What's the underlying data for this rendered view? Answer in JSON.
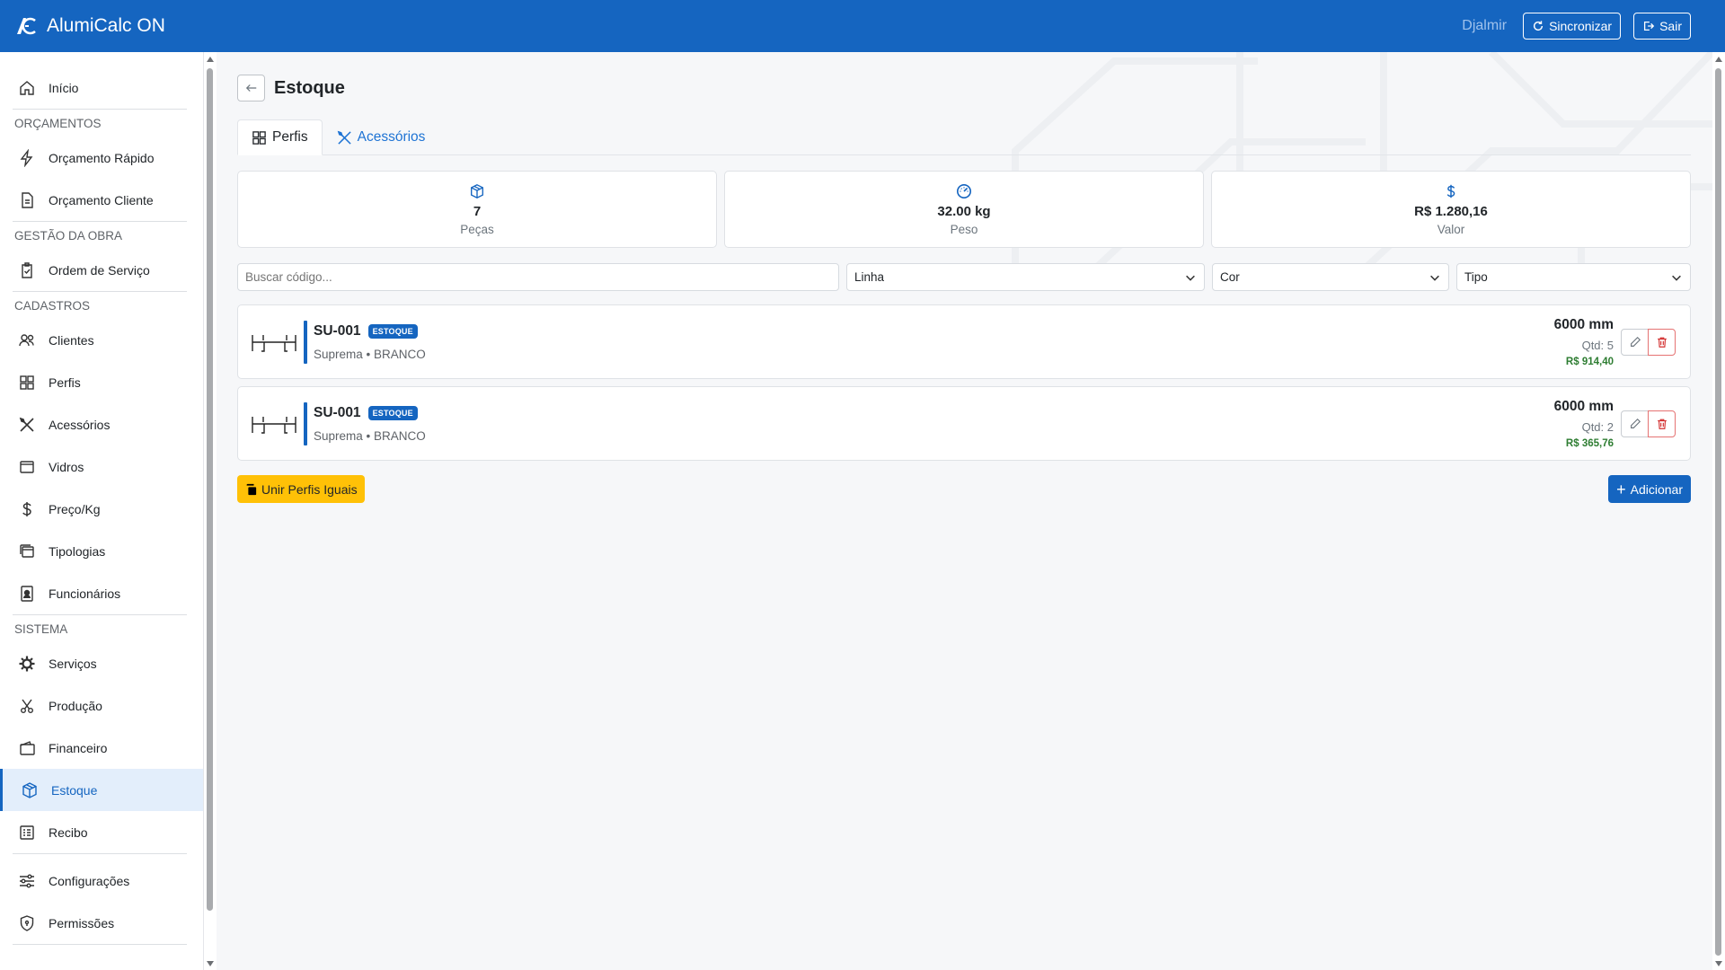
{
  "app": {
    "title": "AlumiCalc ON"
  },
  "header": {
    "user": "Djalmir",
    "sync_label": "Sincronizar",
    "exit_label": "Sair"
  },
  "sidebar": {
    "home": "Início",
    "sections": {
      "orcamentos": "ORÇAMENTOS",
      "gestao": "GESTÃO DA OBRA",
      "cadastros": "CADASTROS",
      "sistema": "SISTEMA"
    },
    "items": {
      "orcamento_rapido": "Orçamento Rápido",
      "orcamento_cliente": "Orçamento Cliente",
      "ordem_servico": "Ordem de Serviço",
      "clientes": "Clientes",
      "perfis": "Perfis",
      "acessorios": "Acessórios",
      "vidros": "Vidros",
      "preco_kg": "Preço/Kg",
      "tipologias": "Tipologias",
      "funcionarios": "Funcionários",
      "servicos": "Serviços",
      "producao": "Produção",
      "financeiro": "Financeiro",
      "estoque": "Estoque",
      "recibo": "Recibo",
      "configuracoes": "Configurações",
      "permissoes": "Permissões"
    },
    "active": "estoque"
  },
  "page": {
    "title": "Estoque",
    "tabs": [
      {
        "label": "Perfis",
        "active": true
      },
      {
        "label": "Acessórios",
        "active": false
      }
    ]
  },
  "stats": [
    {
      "icon": "box-icon",
      "value": "7",
      "label": "Peças"
    },
    {
      "icon": "gauge-icon",
      "value": "32.00 kg",
      "label": "Peso"
    },
    {
      "icon": "dollar-icon",
      "value": "R$ 1.280,16",
      "label": "Valor"
    }
  ],
  "filters": {
    "search_placeholder": "Buscar código...",
    "linha": "Linha",
    "cor": "Cor",
    "tipo": "Tipo"
  },
  "items": [
    {
      "code": "SU-001",
      "badge": "ESTOQUE",
      "line": "Suprema • BRANCO",
      "length": "6000 mm",
      "qty": "Qtd: 5",
      "price": "R$ 914,40"
    },
    {
      "code": "SU-001",
      "badge": "ESTOQUE",
      "line": "Suprema • BRANCO",
      "length": "6000 mm",
      "qty": "Qtd: 2",
      "price": "R$ 365,76"
    }
  ],
  "actions": {
    "merge_label": "Unir Perfis Iguais",
    "add_label": "Adicionar"
  },
  "colors": {
    "primary": "#1565c0",
    "warning": "#ffc107",
    "success": "#2e7d32",
    "danger": "#d32f2f"
  }
}
